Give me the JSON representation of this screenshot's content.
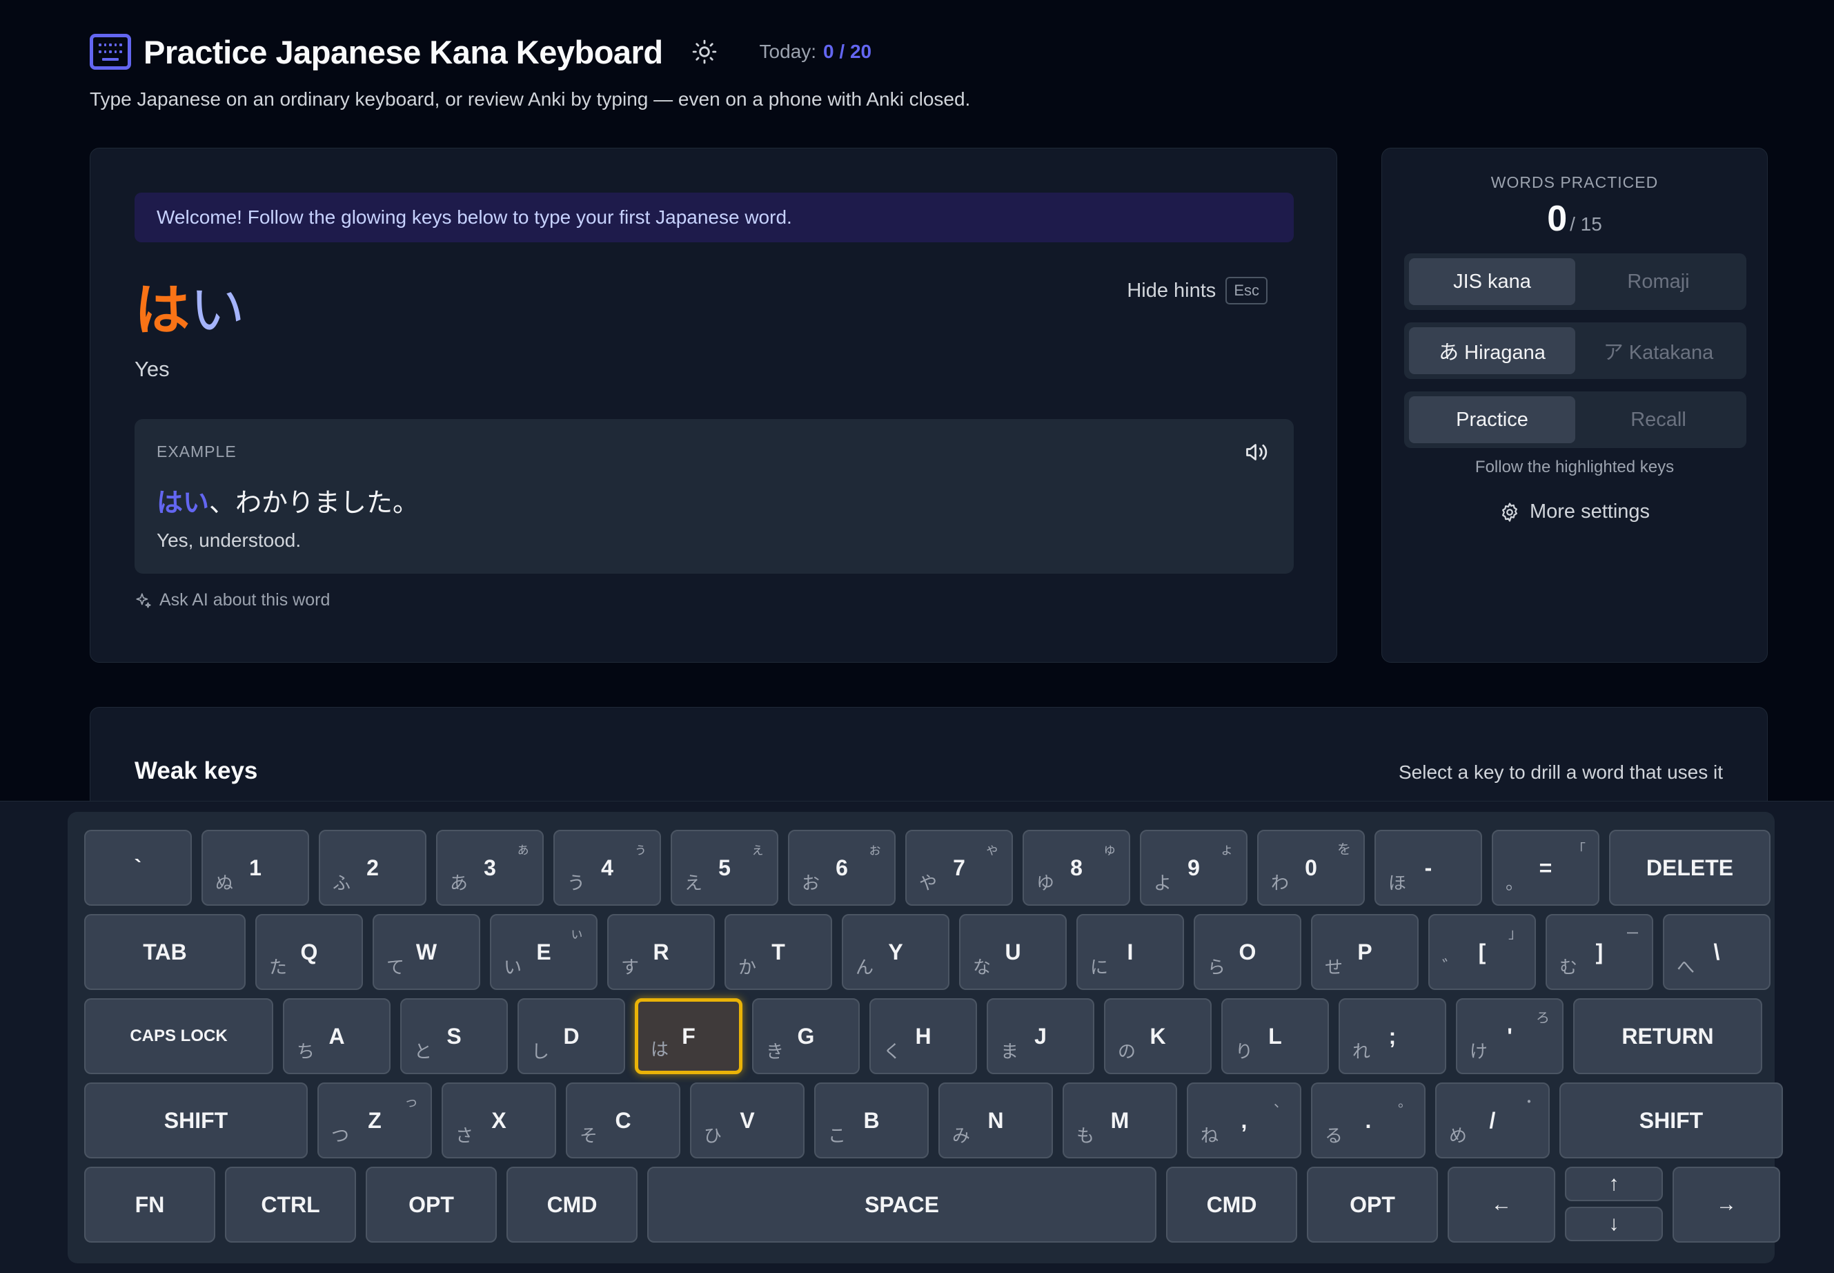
{
  "header": {
    "title": "Practice Japanese Kana Keyboard",
    "today_label": "Today:",
    "today_value": "0 / 20",
    "subtitle": "Type Japanese on an ordinary keyboard, or review Anki by typing — even on a phone with Anki closed."
  },
  "lesson": {
    "welcome": "Welcome! Follow the glowing keys below to type your first Japanese word.",
    "word_typed": "は",
    "word_remaining": "い",
    "hide_hints": "Hide hints",
    "hide_hints_key": "Esc",
    "meaning": "Yes",
    "example": {
      "label": "EXAMPLE",
      "jp_highlight": "はい",
      "jp_rest": "、わかりました。",
      "en": "Yes, understood."
    },
    "ask_ai": "Ask AI about this word"
  },
  "side": {
    "words_practiced_label": "WORDS PRACTICED",
    "words_practiced_count": "0",
    "words_practiced_total": "/ 15",
    "layout_toggle": [
      "JIS kana",
      "Romaji"
    ],
    "script_toggle": [
      "あ Hiragana",
      "ア Katakana"
    ],
    "mode_toggle": [
      "Practice",
      "Recall"
    ],
    "mode_hint": "Follow the highlighted keys",
    "more_settings": "More settings"
  },
  "weak_keys": {
    "title": "Weak keys",
    "hint": "Select a key to drill a word that uses it"
  },
  "keyboard": {
    "highlighted_key": "F",
    "rows": [
      [
        {
          "label": "`",
          "kana": "",
          "shift": ""
        },
        {
          "label": "1",
          "kana": "ぬ",
          "shift": ""
        },
        {
          "label": "2",
          "kana": "ふ",
          "shift": ""
        },
        {
          "label": "3",
          "kana": "あ",
          "shift": "ぁ"
        },
        {
          "label": "4",
          "kana": "う",
          "shift": "ぅ"
        },
        {
          "label": "5",
          "kana": "え",
          "shift": "ぇ"
        },
        {
          "label": "6",
          "kana": "お",
          "shift": "ぉ"
        },
        {
          "label": "7",
          "kana": "や",
          "shift": "ゃ"
        },
        {
          "label": "8",
          "kana": "ゆ",
          "shift": "ゅ"
        },
        {
          "label": "9",
          "kana": "よ",
          "shift": "ょ"
        },
        {
          "label": "0",
          "kana": "わ",
          "shift": "を"
        },
        {
          "label": "-",
          "kana": "ほ",
          "shift": ""
        },
        {
          "label": "=",
          "kana": "。",
          "shift": "「"
        },
        {
          "label": "DELETE",
          "kana": "",
          "shift": ""
        }
      ],
      [
        {
          "label": "TAB",
          "kana": "",
          "shift": ""
        },
        {
          "label": "Q",
          "kana": "た",
          "shift": ""
        },
        {
          "label": "W",
          "kana": "て",
          "shift": ""
        },
        {
          "label": "E",
          "kana": "い",
          "shift": "ぃ"
        },
        {
          "label": "R",
          "kana": "す",
          "shift": ""
        },
        {
          "label": "T",
          "kana": "か",
          "shift": ""
        },
        {
          "label": "Y",
          "kana": "ん",
          "shift": ""
        },
        {
          "label": "U",
          "kana": "な",
          "shift": ""
        },
        {
          "label": "I",
          "kana": "に",
          "shift": ""
        },
        {
          "label": "O",
          "kana": "ら",
          "shift": ""
        },
        {
          "label": "P",
          "kana": "せ",
          "shift": ""
        },
        {
          "label": "[",
          "kana": "゛",
          "shift": "」"
        },
        {
          "label": "]",
          "kana": "む",
          "shift": "ー"
        },
        {
          "label": "\\",
          "kana": "へ",
          "shift": ""
        }
      ],
      [
        {
          "label": "CAPS LOCK",
          "kana": "",
          "shift": ""
        },
        {
          "label": "A",
          "kana": "ち",
          "shift": ""
        },
        {
          "label": "S",
          "kana": "と",
          "shift": ""
        },
        {
          "label": "D",
          "kana": "し",
          "shift": ""
        },
        {
          "label": "F",
          "kana": "は",
          "shift": ""
        },
        {
          "label": "G",
          "kana": "き",
          "shift": ""
        },
        {
          "label": "H",
          "kana": "く",
          "shift": ""
        },
        {
          "label": "J",
          "kana": "ま",
          "shift": ""
        },
        {
          "label": "K",
          "kana": "の",
          "shift": ""
        },
        {
          "label": "L",
          "kana": "り",
          "shift": ""
        },
        {
          "label": ";",
          "kana": "れ",
          "shift": ""
        },
        {
          "label": "'",
          "kana": "け",
          "shift": "ろ"
        },
        {
          "label": "RETURN",
          "kana": "",
          "shift": ""
        }
      ],
      [
        {
          "label": "SHIFT",
          "kana": "",
          "shift": ""
        },
        {
          "label": "Z",
          "kana": "つ",
          "shift": "っ"
        },
        {
          "label": "X",
          "kana": "さ",
          "shift": ""
        },
        {
          "label": "C",
          "kana": "そ",
          "shift": ""
        },
        {
          "label": "V",
          "kana": "ひ",
          "shift": ""
        },
        {
          "label": "B",
          "kana": "こ",
          "shift": ""
        },
        {
          "label": "N",
          "kana": "み",
          "shift": ""
        },
        {
          "label": "M",
          "kana": "も",
          "shift": ""
        },
        {
          "label": ",",
          "kana": "ね",
          "shift": "、"
        },
        {
          "label": ".",
          "kana": "る",
          "shift": "。"
        },
        {
          "label": "/",
          "kana": "め",
          "shift": "・"
        },
        {
          "label": "SHIFT",
          "kana": "",
          "shift": ""
        }
      ],
      [
        {
          "label": "FN",
          "kana": "",
          "shift": ""
        },
        {
          "label": "CTRL",
          "kana": "",
          "shift": ""
        },
        {
          "label": "OPT",
          "kana": "",
          "shift": ""
        },
        {
          "label": "CMD",
          "kana": "",
          "shift": ""
        },
        {
          "label": "SPACE",
          "kana": "",
          "shift": ""
        },
        {
          "label": "CMD",
          "kana": "",
          "shift": ""
        },
        {
          "label": "OPT",
          "kana": "",
          "shift": ""
        },
        {
          "label": "←",
          "kana": "",
          "shift": ""
        },
        {
          "label": "↑",
          "kana": "",
          "shift": ""
        },
        {
          "label": "↓",
          "kana": "",
          "shift": ""
        },
        {
          "label": "→",
          "kana": "",
          "shift": ""
        }
      ]
    ]
  },
  "colors": {
    "accent": "#6366f1",
    "typed_char": "#f97316",
    "glow": "#eab308"
  }
}
